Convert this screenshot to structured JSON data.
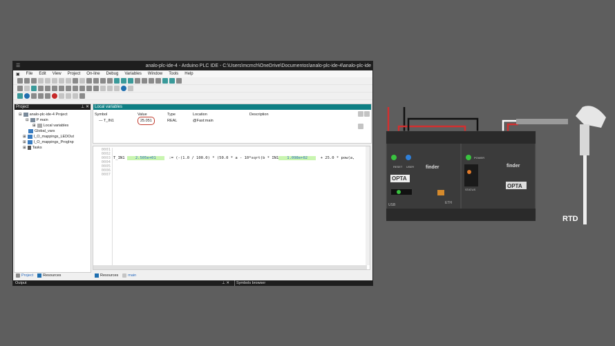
{
  "window": {
    "title": "analo-plc-ide-4 - Arduino PLC IDE - C:\\Users\\mcmch\\OneDrive\\Documentos\\analo-plc-ide-4\\analo-plc-ide"
  },
  "menu": [
    "File",
    "Edit",
    "View",
    "Project",
    "On-line",
    "Debug",
    "Variables",
    "Window",
    "Tools",
    "Help"
  ],
  "project_panel": {
    "title": "Project",
    "tree": [
      {
        "label": "analo-plc-ide-4 Project"
      },
      {
        "label": "P main"
      },
      {
        "label": "Local variables"
      },
      {
        "label": "Global_vars"
      },
      {
        "label": "I_O_mappings_LEDOut"
      },
      {
        "label": "I_O_mappings_ProgInp"
      },
      {
        "label": "Tasks"
      }
    ],
    "tabs": [
      "Project",
      "Resources"
    ]
  },
  "local_vars": {
    "title": "Local variables",
    "headers": [
      "Symbol",
      "Value",
      "Type",
      "Location",
      "Description"
    ],
    "rows": [
      {
        "symbol": "T_IN1",
        "value": "25.051",
        "type": "REAL",
        "location": "@Fast:main",
        "description": ""
      }
    ]
  },
  "code": {
    "line_numbers": [
      "0001",
      "0002",
      "0003",
      "0004",
      "0005",
      "0006",
      "0007"
    ],
    "var1": "T_IN1",
    "val1": "2.505e+01",
    "expr1": ":= (-(1.0 / 100.0) * (50.0 * a - 10*sqrt(b * IN1",
    "val2": "1.098e+02",
    "expr2": "+ 25.0 * pow(a,"
  },
  "editor_tabs": [
    "Resources",
    "main"
  ],
  "bottom": {
    "output": "Output",
    "symbols": "Symbols browser"
  },
  "hardware": {
    "brand": "finder",
    "model": "OPTA",
    "power": "POWER",
    "status": "STATUS",
    "reset": "RESET",
    "user": "USER",
    "usb": "USB",
    "eth": "ETH",
    "sensor": "RTD"
  },
  "colors": {
    "accent": "#0e7f84",
    "highlight": "#c9f5b0",
    "value_circle": "#c0392b"
  }
}
